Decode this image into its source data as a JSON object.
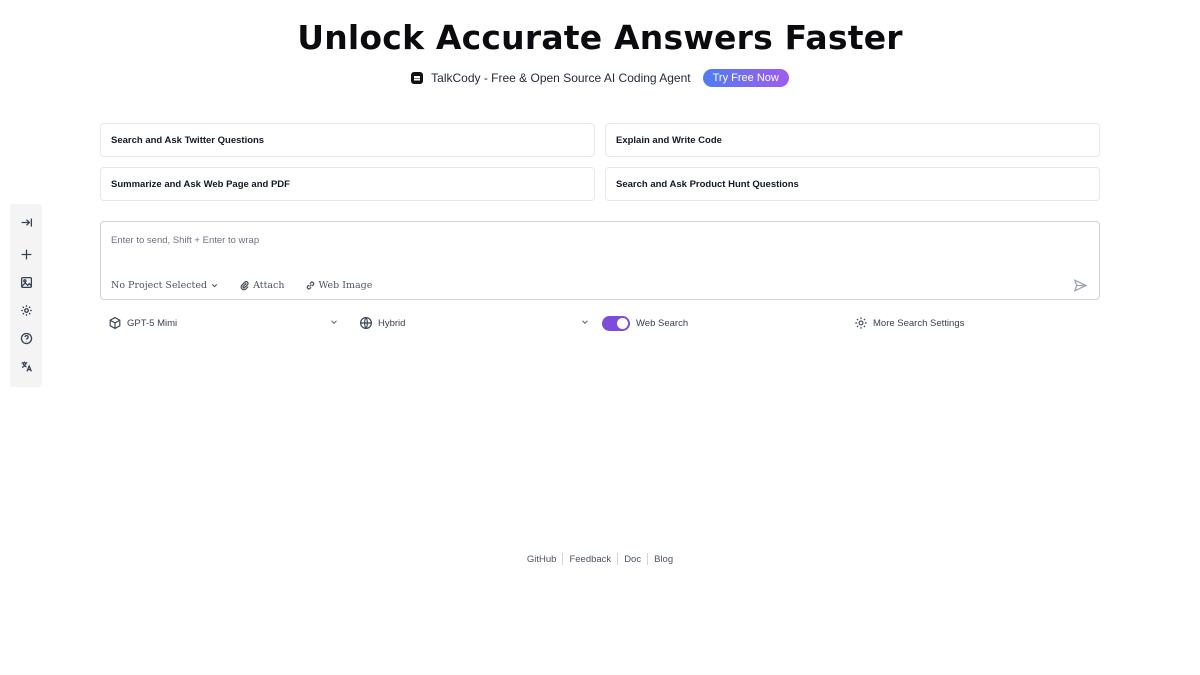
{
  "hero": {
    "title": "Unlock Accurate Answers Faster"
  },
  "promo": {
    "logo_icon": "chat-bubble-icon",
    "text": "TalkCody - Free & Open Source AI Coding Agent",
    "button_label": "Try Free Now",
    "button_gradient": [
      "#4f7df0",
      "#9f5bf0"
    ]
  },
  "suggestions": [
    {
      "label": "Search and Ask Twitter Questions"
    },
    {
      "label": "Explain and Write Code"
    },
    {
      "label": "Summarize and Ask Web Page and PDF"
    },
    {
      "label": "Search and Ask Product Hunt Questions"
    }
  ],
  "sidebar": {
    "items": [
      {
        "icon": "collapse-arrow-icon"
      },
      {
        "icon": "plus-icon"
      },
      {
        "icon": "image-icon"
      },
      {
        "icon": "gear-icon"
      },
      {
        "icon": "help-circle-icon"
      },
      {
        "icon": "translate-icon"
      }
    ]
  },
  "composer": {
    "placeholder": "Enter to send, Shift + Enter to wrap",
    "project_label": "No Project Selected",
    "attach_label": "Attach",
    "web_image_label": "Web Image",
    "send_icon": "send-icon"
  },
  "options": {
    "model_label": "GPT-5 Mimi",
    "mode_label": "Hybrid",
    "web_search_label": "Web Search",
    "web_search_enabled": true,
    "toggle_color": "#7c4ddb",
    "more_settings_label": "More Search Settings"
  },
  "footer": {
    "links": [
      {
        "label": "GitHub"
      },
      {
        "label": "Feedback"
      },
      {
        "label": "Doc"
      },
      {
        "label": "Blog"
      }
    ]
  }
}
